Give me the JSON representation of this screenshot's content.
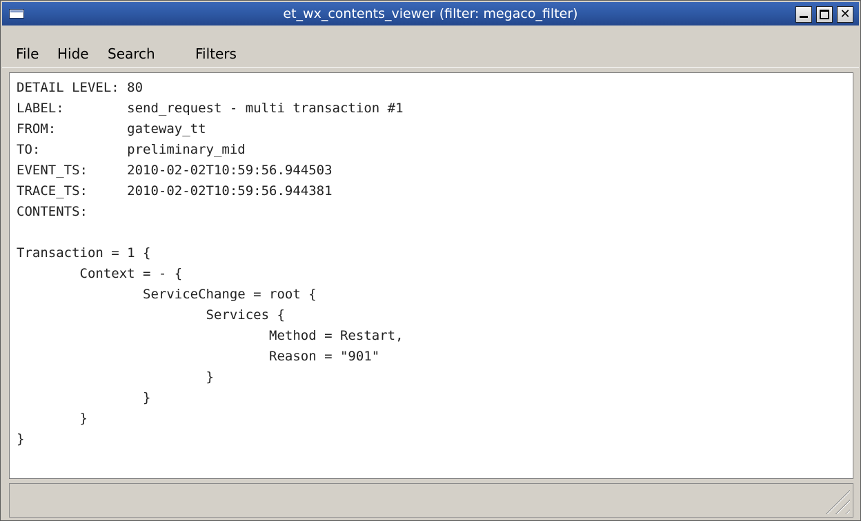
{
  "window": {
    "title": "et_wx_contents_viewer (filter: megaco_filter)",
    "controls": {
      "minimize_glyph": "",
      "maximize_glyph": "",
      "close_glyph": "✕"
    }
  },
  "menu": {
    "items": [
      "File",
      "Hide",
      "Search",
      "Filters"
    ]
  },
  "contents": {
    "lines": [
      "DETAIL LEVEL: 80",
      "LABEL:        send_request - multi transaction #1",
      "FROM:         gateway_tt",
      "TO:           preliminary_mid",
      "EVENT_TS:     2010-02-02T10:59:56.944503",
      "TRACE_TS:     2010-02-02T10:59:56.944381",
      "CONTENTS:",
      "",
      "Transaction = 1 {",
      "        Context = - {",
      "                ServiceChange = root {",
      "                        Services {",
      "                                Method = Restart,",
      "                                Reason = \"901\"",
      "                        }",
      "                }",
      "        }",
      "}"
    ]
  },
  "status": {
    "text": ""
  },
  "colors": {
    "titlebar": "#2f5aa6",
    "chrome": "#d4d0c8",
    "content_bg": "#ffffff"
  }
}
